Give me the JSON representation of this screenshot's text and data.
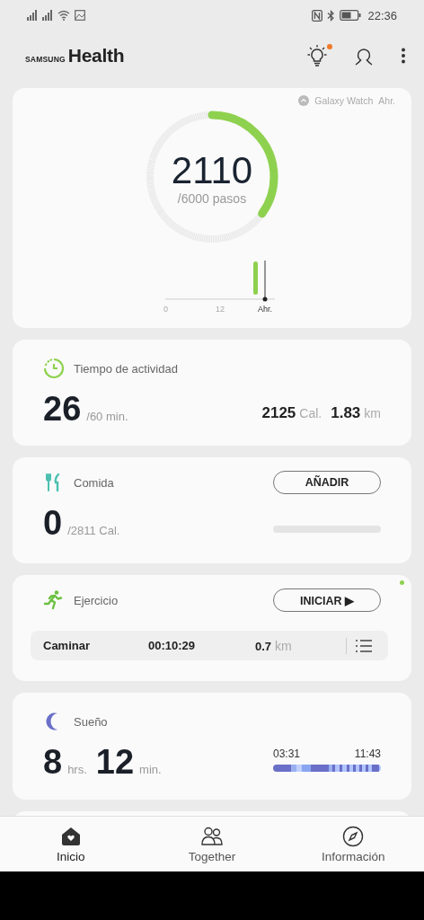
{
  "status_bar": {
    "time": "22:36"
  },
  "app_bar": {
    "logo_small": "SAMSUNG",
    "logo_large": "Health",
    "tips_badge": true
  },
  "steps": {
    "source": "Galaxy Watch",
    "source_time": "Ahr.",
    "count": "2110",
    "goal": "/6000 pasos",
    "level": 0.35,
    "axis_labels": [
      "0",
      "12",
      "Ahr."
    ]
  },
  "activity": {
    "title": "Tiempo de actividad",
    "value": "26",
    "goal": "/60 min.",
    "calories": "2125",
    "calories_unit": "Cal.",
    "distance": "1.83",
    "distance_unit": "km"
  },
  "food": {
    "title": "Comida",
    "button": "AÑADIR",
    "value": "0",
    "goal": "/2811 Cal.",
    "level": 0
  },
  "exercise": {
    "title": "Ejercicio",
    "button": "INICIAR ▶",
    "new_indicator": true,
    "last": {
      "type": "Caminar",
      "duration": "00:10:29",
      "distance": "0.7",
      "distance_unit": "km"
    }
  },
  "sleep": {
    "title": "Sueño",
    "hours": "8",
    "hours_unit": "hrs.",
    "minutes": "12",
    "minutes_unit": "min.",
    "start": "03:31",
    "end": "11:43"
  },
  "nav": [
    {
      "label": "Inicio",
      "selected": true
    },
    {
      "label": "Together",
      "selected": false
    },
    {
      "label": "Información",
      "selected": false
    }
  ]
}
